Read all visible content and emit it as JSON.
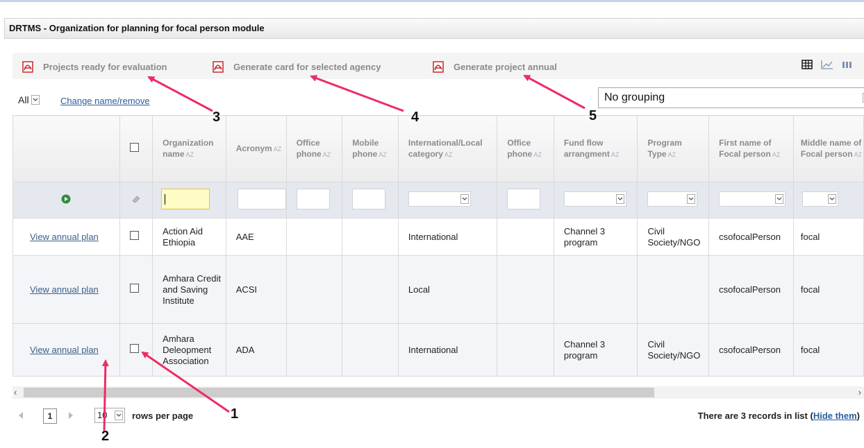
{
  "panel": {
    "title": "DRTMS - Organization for planning for focal person module"
  },
  "toolbar": {
    "items": [
      {
        "label": "Projects ready for evaluation",
        "icon": "pdf-icon"
      },
      {
        "label": "Generate card for selected agency",
        "icon": "pdf-icon"
      },
      {
        "label": "Generate project annual",
        "icon": "pdf-icon"
      }
    ],
    "view_icons": [
      "table-view-icon",
      "chart-view-icon",
      "column-view-icon"
    ]
  },
  "filter_bar": {
    "scope_value": "All",
    "change_link": "Change name/remove",
    "grouping_value": "No grouping"
  },
  "columns": [
    "Organization name",
    "Acronym",
    "Office phone",
    "Mobile phone",
    "International/Local category",
    "Office phone",
    "Fund flow arrangment",
    "Program Type",
    "First name of Focal person",
    "Middle name of Focal person"
  ],
  "rows": [
    {
      "action": "View annual plan",
      "org": "Action Aid Ethiopia",
      "acronym": "AAE",
      "office_phone": "",
      "mobile_phone": "",
      "category": "International",
      "office_phone2": "",
      "fund_flow": "Channel 3 program",
      "program_type": "Civil Society/NGO",
      "first_name": "csofocalPerson",
      "middle_name": "focal"
    },
    {
      "action": "View annual plan",
      "org": "Amhara Credit and Saving Institute",
      "acronym": "ACSI",
      "office_phone": "",
      "mobile_phone": "",
      "category": "Local",
      "office_phone2": "",
      "fund_flow": "",
      "program_type": "",
      "first_name": "csofocalPerson",
      "middle_name": "focal"
    },
    {
      "action": "View annual plan",
      "org": "Amhara Deleopment Association",
      "acronym": "ADA",
      "office_phone": "",
      "mobile_phone": "",
      "category": "International",
      "office_phone2": "",
      "fund_flow": "Channel 3 program",
      "program_type": "Civil Society/NGO",
      "first_name": "csofocalPerson",
      "middle_name": "focal"
    }
  ],
  "pager": {
    "page": "1",
    "rows_per_page": "10",
    "rows_label": "rows per page",
    "records_text": "There are 3 records in list (",
    "hide_link": "Hide them",
    "records_close": ")"
  },
  "callouts": [
    "1",
    "2",
    "3",
    "4",
    "5"
  ],
  "colors": {
    "arrow": "#ee2b63",
    "pdf": "#c8262b",
    "link": "#2a5d9a"
  }
}
